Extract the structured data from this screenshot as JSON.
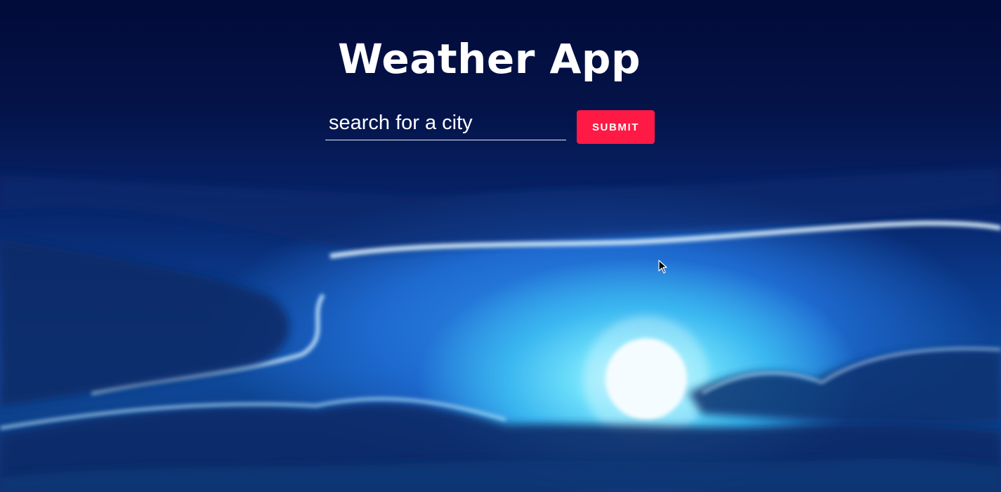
{
  "app": {
    "title": "Weather App"
  },
  "search": {
    "placeholder": "search for a city",
    "value": ""
  },
  "submit": {
    "label": "SUBMIT"
  },
  "colors": {
    "accent": "#ff1a45",
    "background_top": "#020b3a",
    "text": "#ffffff"
  },
  "icons": {
    "cursor": "mouse-pointer-icon"
  }
}
